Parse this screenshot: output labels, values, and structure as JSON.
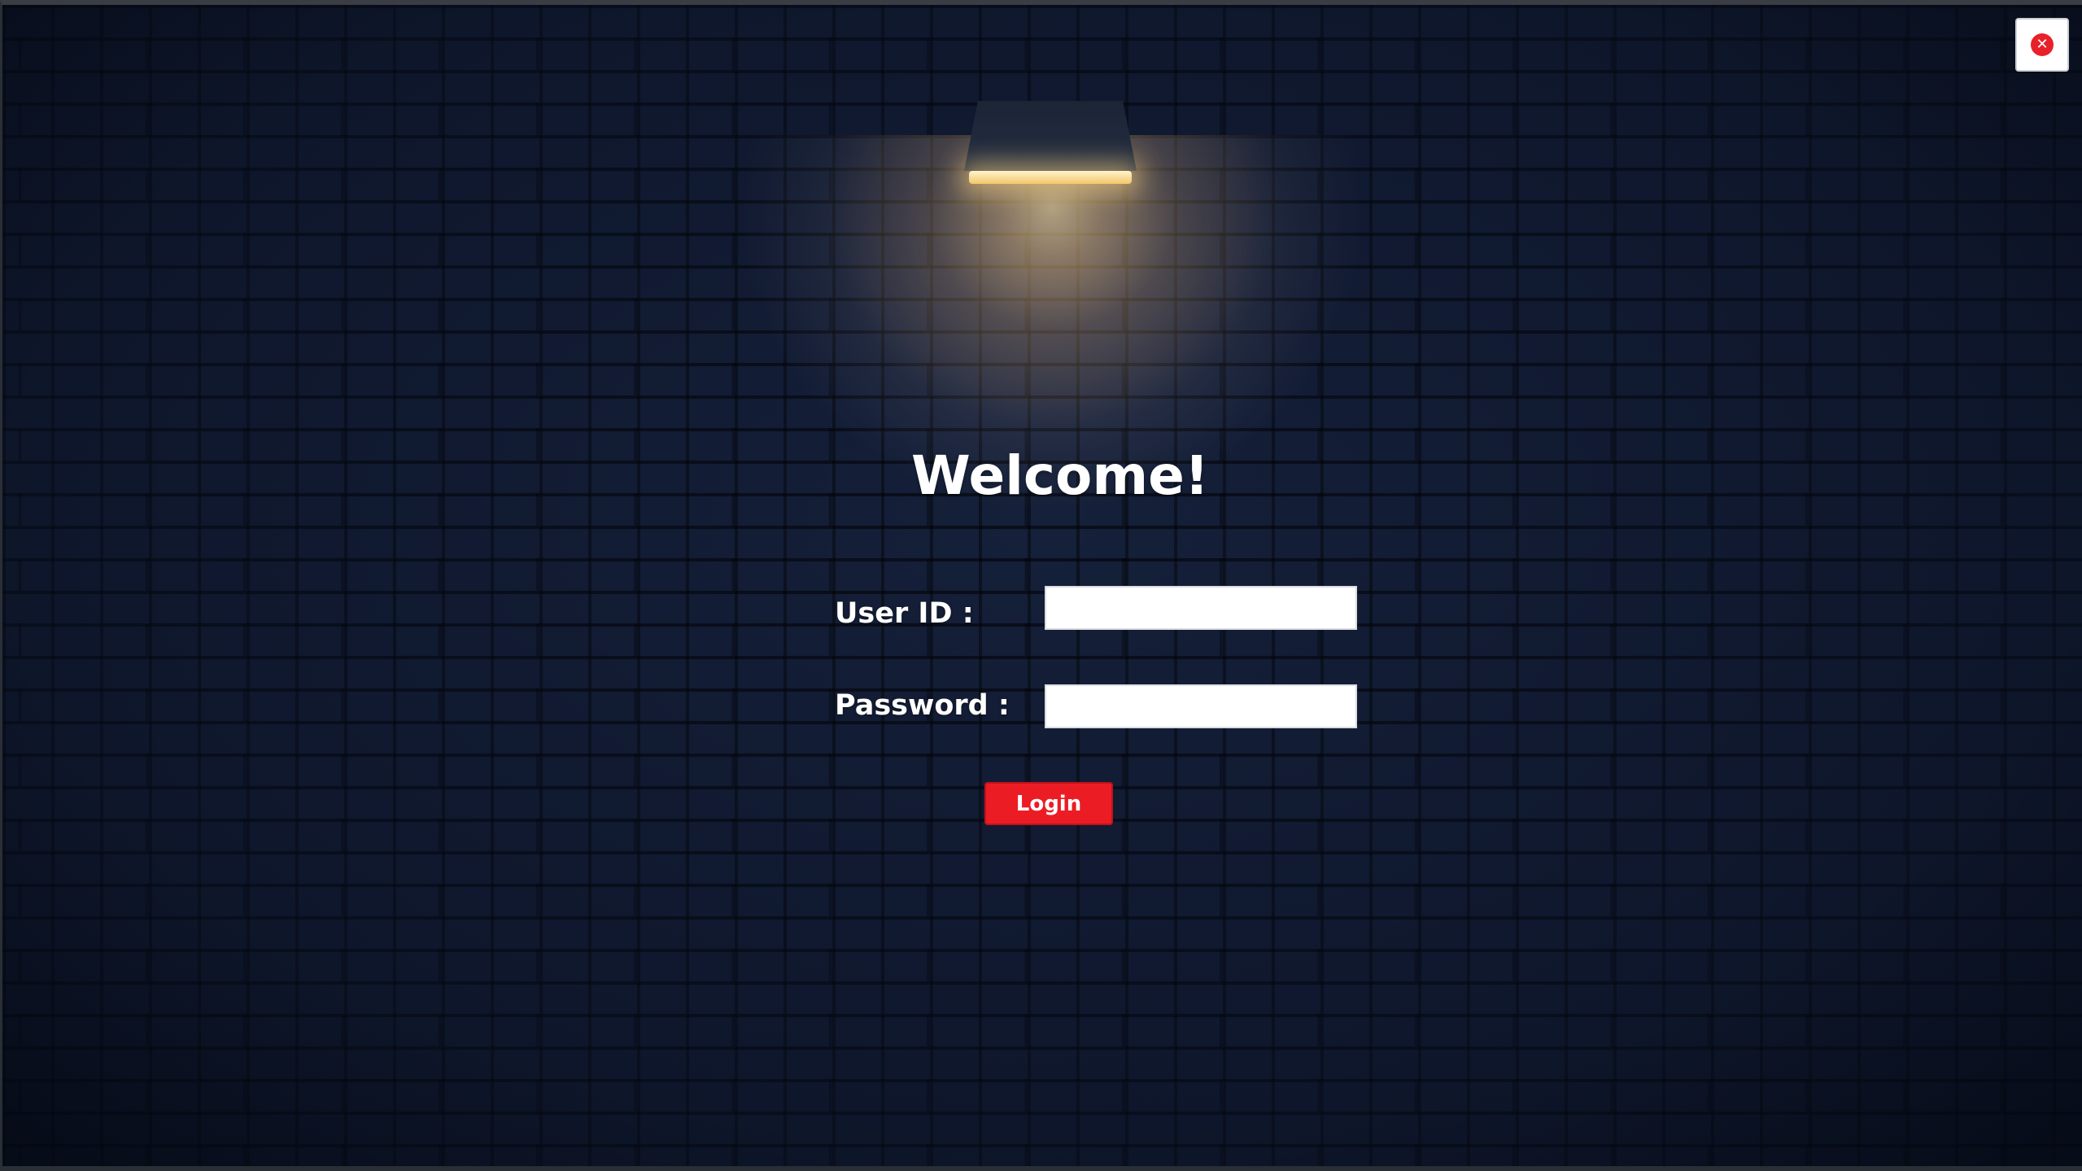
{
  "window": {
    "close_icon": "close-icon"
  },
  "login_form": {
    "title": "Welcome!",
    "user_id_label": "User ID :",
    "user_id_value": "",
    "password_label": "Password :",
    "password_value": "",
    "login_button_label": "Login"
  },
  "colors": {
    "accent": "#ec1c24",
    "background": "#15203a",
    "text": "#ffffff",
    "lamp_light": "#ffe096"
  }
}
